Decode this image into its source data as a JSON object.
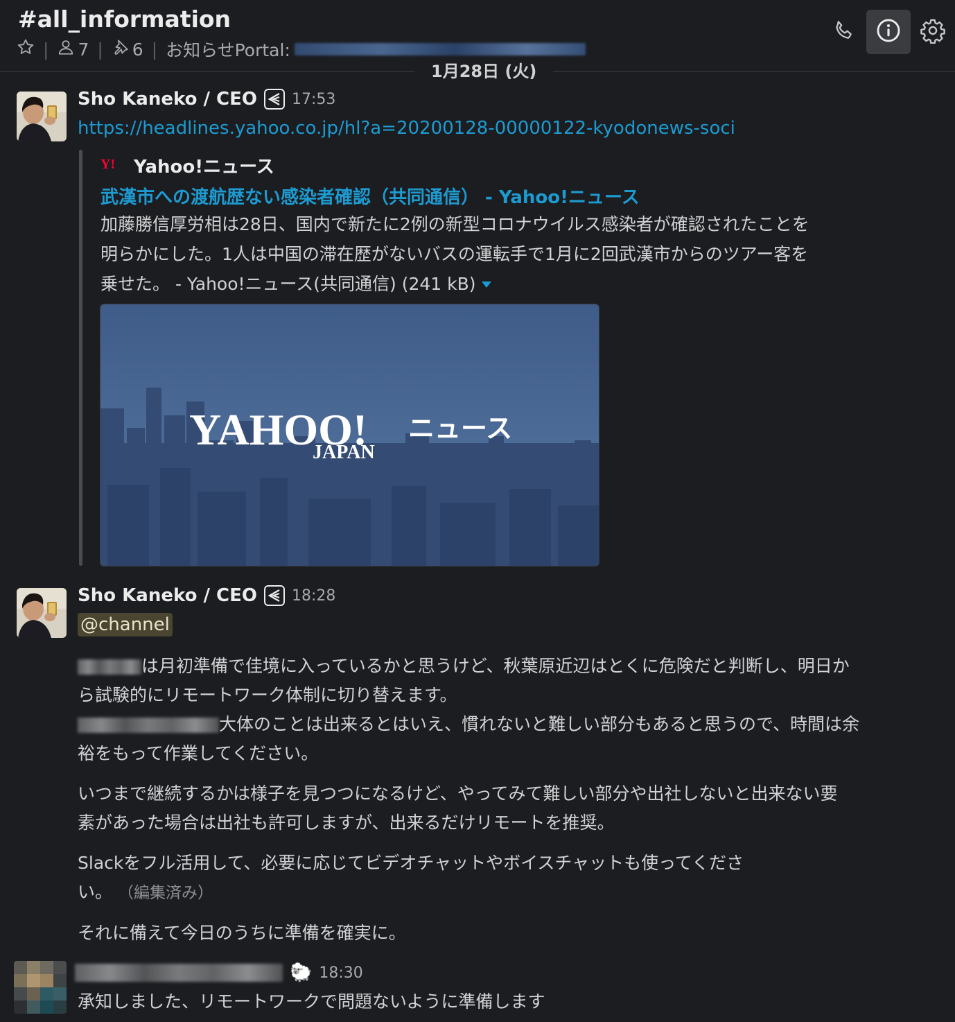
{
  "header": {
    "channel": "#all_information",
    "members_count": "7",
    "pins_count": "6",
    "topic_label": "お知らせPortal:",
    "icons": [
      "star-icon",
      "person-icon",
      "pin-icon",
      "phone-icon",
      "info-icon",
      "gear-icon"
    ]
  },
  "date_divider": "1月28日 (火)",
  "messages": [
    {
      "user": "Sho Kaneko / CEO",
      "time": "17:53",
      "link": "https://headlines.yahoo.co.jp/hl?a=20200128-00000122-kyodonews-soci",
      "attachment": {
        "service": "Yahoo!ニュース",
        "title": "武漢市への渡航歴ない感染者確認（共同通信） - Yahoo!ニュース",
        "body_line1": "加藤勝信厚労相は28日、国内で新たに2例の新型コロナウイルス感染者が確認されたことを",
        "body_line2": "明らかにした。1人は中国の滞在歴がないバスの運転手で1月に2回武漢市からのツアー客を",
        "body_line3": "乗せた。 - Yahoo!ニュース(共同通信) (241 kB)",
        "image_logo": "YAHOO!",
        "image_logo_sub": "JAPAN",
        "image_logo_news": "ニュース"
      }
    },
    {
      "user": "Sho Kaneko / CEO",
      "time": "18:28",
      "mention": "@channel",
      "p1_line1": "は月初準備で佳境に入っているかと思うけど、秋葉原近辺はとくに危険だと判断し、明日か",
      "p1_line2": "ら試験的にリモートワーク体制に切り替えます。",
      "p1_line3": "大体のことは出来るとはいえ、慣れないと難しい部分もあると思うので、時間は余",
      "p1_line4": "裕をもって作業してください。",
      "p2_line1": "いつまで継続するかは様子を見つつになるけど、やってみて難しい部分や出社しないと出来ない要",
      "p2_line2": "素があった場合は出社も許可しますが、出来るだけリモートを推奨。",
      "p3_line1": "Slackをフル活用して、必要に応じてビデオチャットやボイスチャットも使ってくださ",
      "p3_line2": "い。",
      "edited": "（編集済み）",
      "p4": "それに備えて今日のうちに準備を確実に。"
    },
    {
      "time": "18:30",
      "status_emoji": "🐑",
      "text": "承知しました、リモートワークで問題ないように準備します"
    }
  ],
  "colors": {
    "background": "#1b1d21",
    "link": "#1d9bd1",
    "mention_bg": "#4a4530",
    "yahoo_red": "#ff0033"
  }
}
